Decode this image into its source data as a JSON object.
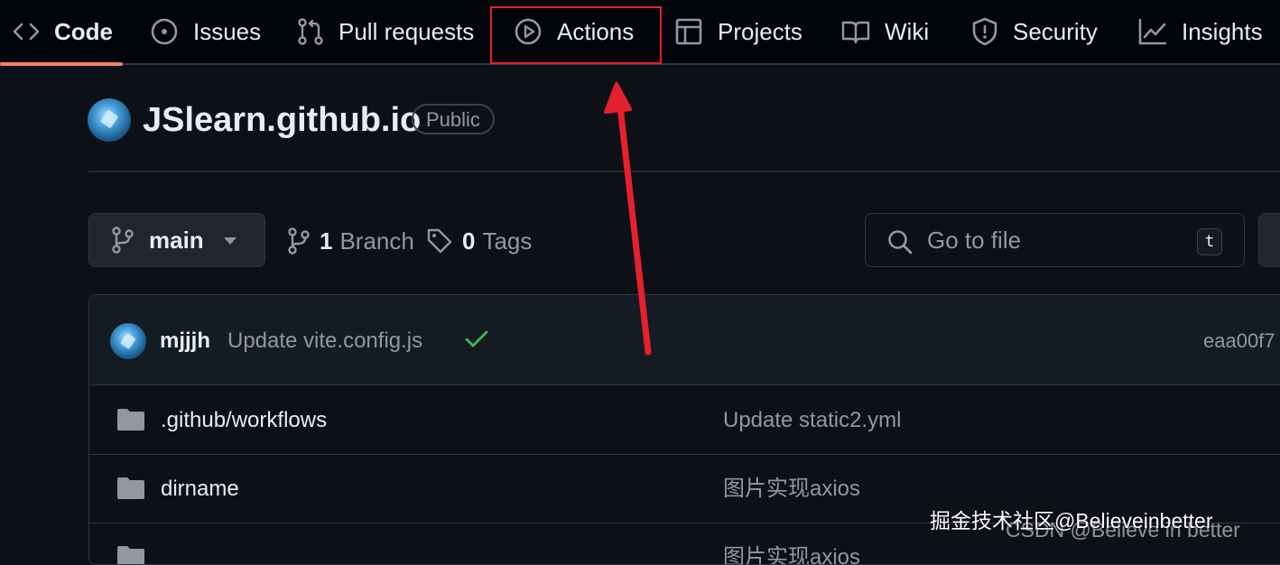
{
  "nav": {
    "tabs": [
      {
        "label": "Code",
        "icon": "code-icon"
      },
      {
        "label": "Issues",
        "icon": "issue-opened-icon"
      },
      {
        "label": "Pull requests",
        "icon": "git-pull-request-icon"
      },
      {
        "label": "Actions",
        "icon": "play-icon"
      },
      {
        "label": "Projects",
        "icon": "table-icon"
      },
      {
        "label": "Wiki",
        "icon": "book-icon"
      },
      {
        "label": "Security",
        "icon": "shield-icon"
      },
      {
        "label": "Insights",
        "icon": "graph-icon"
      }
    ],
    "active_tab": "Code",
    "highlighted_tab": "Actions"
  },
  "repo": {
    "name": "JSlearn.github.io",
    "visibility": "Public"
  },
  "toolbar": {
    "branch": "main",
    "branch_count": "1",
    "branch_label": "Branch",
    "tag_count": "0",
    "tag_label": "Tags",
    "goto_placeholder": "Go to file",
    "goto_shortcut": "t"
  },
  "latest_commit": {
    "author": "mjjjh",
    "message": "Update vite.config.js",
    "status": "success",
    "hash": "eaa00f7"
  },
  "files": [
    {
      "name": ".github/workflows",
      "type": "folder",
      "message": "Update static2.yml"
    },
    {
      "name": "dirname",
      "type": "folder",
      "message": "图片实现axios"
    },
    {
      "name": "",
      "type": "folder",
      "message": "图片实现axios"
    }
  ],
  "annotation": {
    "color": "#e5212b"
  },
  "watermark": {
    "text": "掘金技术社区@Believeinbetter",
    "text_secondary": "CSDN @Believe in better"
  },
  "colors": {
    "background": "#0d1117",
    "nav_background": "#010409",
    "active_underline": "#f78166",
    "success": "#3fb950"
  }
}
